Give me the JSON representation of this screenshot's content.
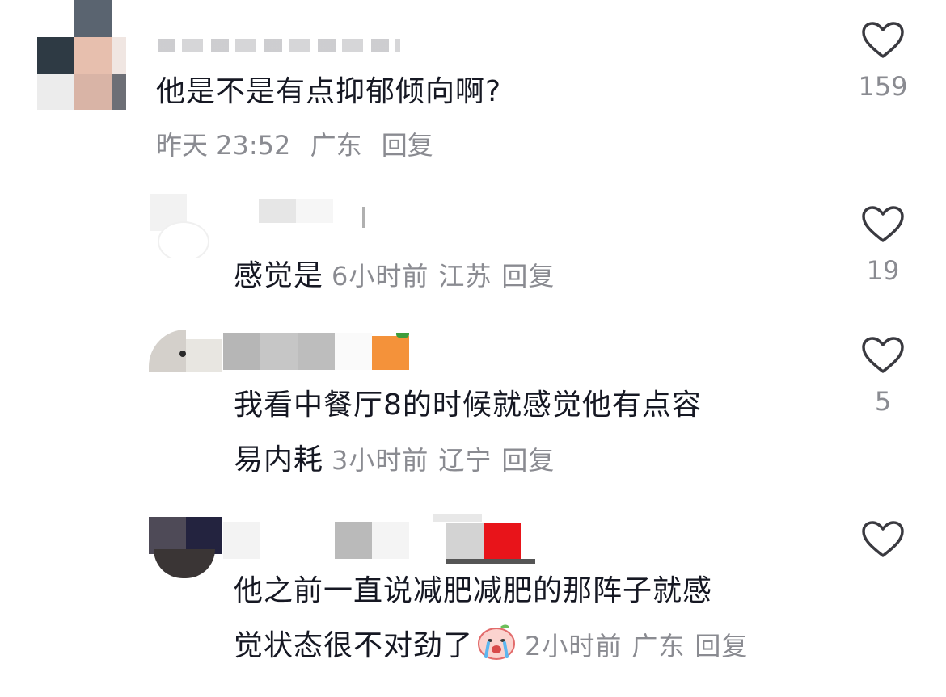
{
  "comments": [
    {
      "text": "他是不是有点抑郁倾向啊?",
      "time": "昨天 23:52",
      "location": "广东",
      "reply": "回复",
      "likes": "159"
    },
    {
      "text": "感觉是",
      "time": "6小时前",
      "location": "江苏",
      "reply": "回复",
      "likes": "19"
    },
    {
      "text_line1": "我看中餐厅8的时候就感觉他有点容",
      "text_line2": "易内耗",
      "time": "3小时前",
      "location": "辽宁",
      "reply": "回复",
      "likes": "5"
    },
    {
      "text_line1": "他之前一直说减肥减肥的那阵子就感",
      "text_line2": "觉状态很不对劲了",
      "emoji": "crying-peach-emoji",
      "time": "2小时前",
      "location": "广东",
      "reply": "回复",
      "likes": ""
    }
  ],
  "icons": {
    "like": "heart-outline-icon"
  },
  "colors": {
    "text": "#161823",
    "meta": "#8a8b91",
    "heart_stroke": "#3a3a40"
  }
}
